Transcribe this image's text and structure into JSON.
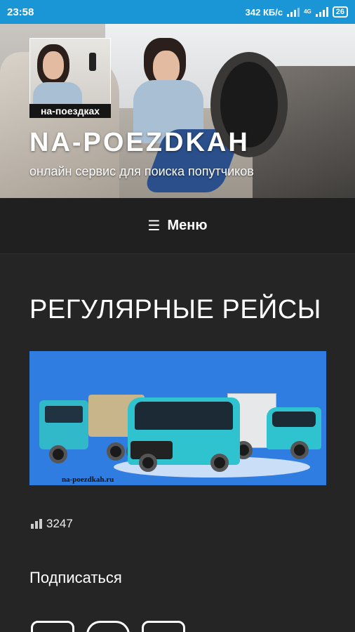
{
  "status_bar": {
    "time": "23:58",
    "speed": "342 КБ/с",
    "network": "4G",
    "battery": "26"
  },
  "header": {
    "logo_label": "на-поездках",
    "site_title": "NA-POEZDKAH",
    "tagline": "онлайн сервис для поиска попутчиков"
  },
  "menu": {
    "icon": "hamburger-icon",
    "label": "Меню"
  },
  "page": {
    "title": "РЕГУЛЯРНЫЕ РЕЙСЫ",
    "image_watermark": "na-poezdkah.ru",
    "view_count": "3247",
    "subscribe_label": "Подписаться"
  },
  "social_icons": [
    "email-icon",
    "search-icon",
    "share-icon"
  ],
  "colors": {
    "status_bar": "#1a95d6",
    "background": "#252525",
    "image_bg": "#2f7de1"
  }
}
